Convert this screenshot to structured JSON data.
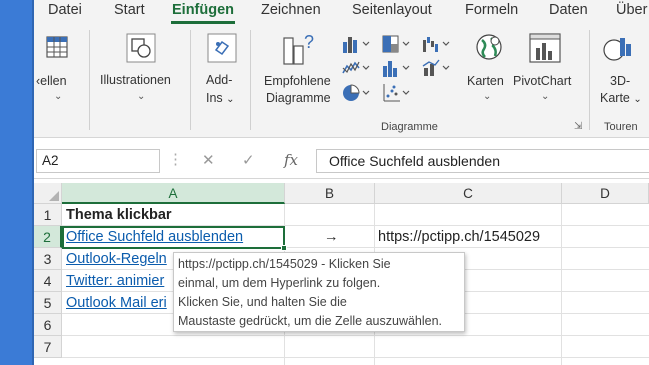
{
  "tabs": [
    "Datei",
    "Start",
    "Einfügen",
    "Zeichnen",
    "Seitenlayout",
    "Formeln",
    "Daten",
    "Über"
  ],
  "active_tab": "Einfügen",
  "ribbon": {
    "tabellen_label": "ellen",
    "illustrationen_label": "Illustrationen",
    "addins_line1": "Add-",
    "addins_line2": "Ins",
    "empfohlene_line1": "Empfohlene",
    "empfohlene_line2": "Diagramme",
    "karten_label": "Karten",
    "pivotchart_label": "PivotChart",
    "karte3d_line1": "3D-",
    "karte3d_line2": "Karte",
    "group_diagramme": "Diagramme",
    "group_touren": "Touren"
  },
  "formula_bar": {
    "name_box": "A2",
    "cancel": "✕",
    "enter": "✓",
    "fx": "fx",
    "formula": "Office Suchfeld ausblenden"
  },
  "columns": [
    "A",
    "B",
    "C",
    "D"
  ],
  "rows": [
    "1",
    "2",
    "3",
    "4",
    "5",
    "6",
    "7"
  ],
  "cells": {
    "a1": "Thema klickbar",
    "a2": "Office Suchfeld ausblenden",
    "a3": "Outlook-Regeln",
    "a4": "Twitter: animier",
    "a5": "Outlook Mail eri",
    "b2": "→",
    "c2": "https://pctipp.ch/1545029"
  },
  "tooltip": [
    "https://pctipp.ch/1545029 - Klicken Sie",
    "einmal, um dem Hyperlink zu folgen.",
    "Klicken Sie, und halten Sie die",
    "Maustaste gedrückt, um die Zelle auszuwählen."
  ],
  "colors": {
    "accent": "#1d6e3a",
    "link": "#0b5cad",
    "icon_blue": "#3b6fb6"
  }
}
